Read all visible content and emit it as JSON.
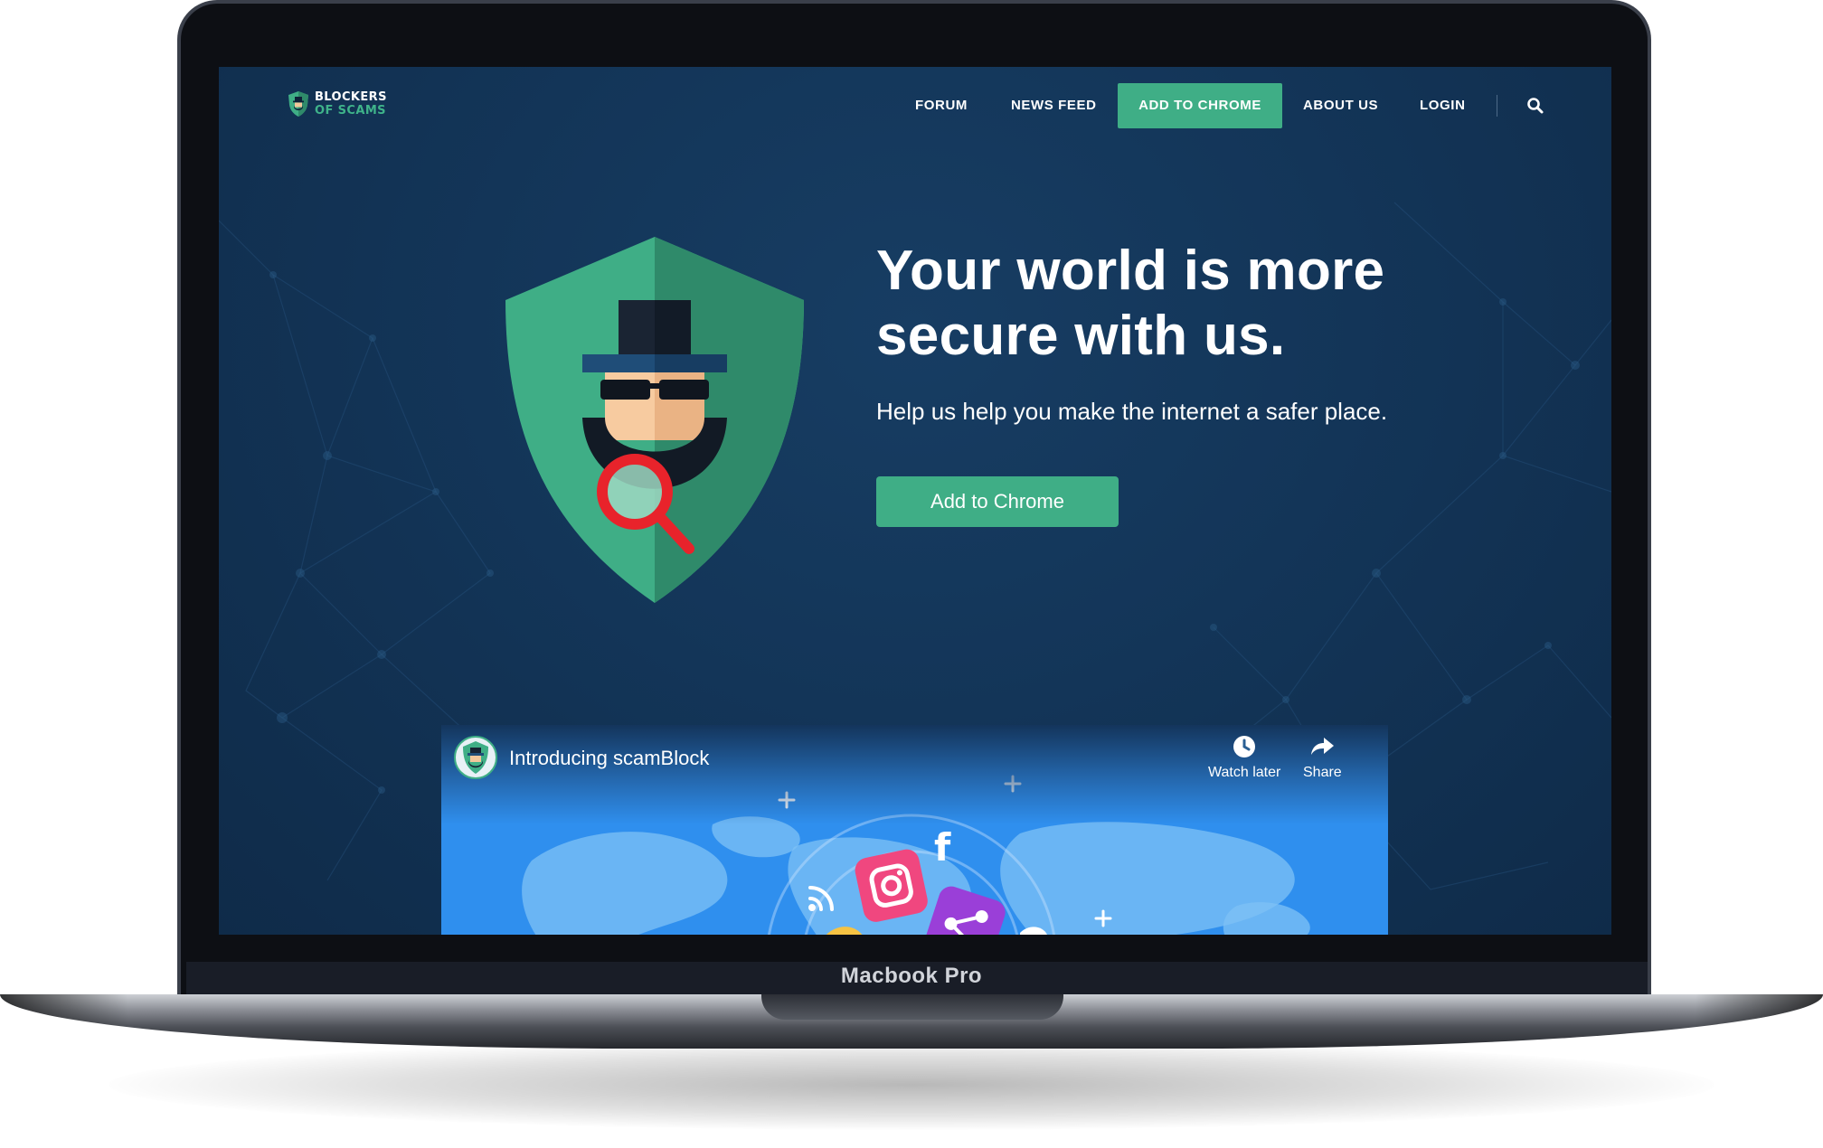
{
  "device": {
    "label": "Macbook Pro"
  },
  "site": {
    "logo": {
      "line1": "BLOCKERS",
      "line2": "OF SCAMS"
    },
    "nav": {
      "forum": "FORUM",
      "news_feed": "NEWS FEED",
      "add_to_chrome": "ADD TO CHROME",
      "about_us": "ABOUT US",
      "login": "LOGIN",
      "search_icon": "search-icon"
    },
    "hero": {
      "title": "Your world is more secure with us.",
      "subtitle": "Help us help you make the internet a safer place.",
      "cta": "Add to Chrome",
      "illustration_icon": "spy-shield-magnifier-icon"
    },
    "video": {
      "title": "Introducing scamBlock",
      "watch_later": "Watch later",
      "share": "Share"
    }
  },
  "colors": {
    "background": "#133558",
    "accent": "#3fae86",
    "text": "#ffffff"
  }
}
